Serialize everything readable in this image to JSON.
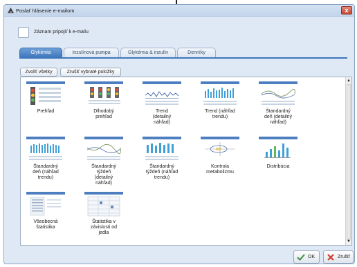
{
  "window": {
    "title": "Poslať hlásenie e-mailom",
    "close_glyph": "x"
  },
  "attach": {
    "label": "Záznam pripojiť k e-mailu",
    "checked": false
  },
  "tabs": [
    {
      "label": "Glykémia",
      "active": true
    },
    {
      "label": "Inzulínová pumpa",
      "active": false
    },
    {
      "label": "Glykémia & inzulín",
      "active": false
    },
    {
      "label": "Denníky",
      "active": false
    }
  ],
  "actions": {
    "select_all": "Zvoliť všetky",
    "deselect": "Zrušiť vybraté položky"
  },
  "reports": [
    {
      "label": "Prehľad",
      "icon": "traffic-light-grid-icon"
    },
    {
      "label": "Dlhodobý\nprehľad",
      "icon": "traffic-light-row-icon"
    },
    {
      "label": "Trend\n(detailný\nnáhľad)",
      "icon": "trend-detail-icon"
    },
    {
      "label": "Trend (náhľad\ntrendu)",
      "icon": "trend-bars-icon"
    },
    {
      "label": "Štandardný\ndeň (detailný\nnáhľad)",
      "icon": "standard-day-detail-icon"
    },
    {
      "label": "Štandardný\ndeň (náhľad\ntrendu)",
      "icon": "standard-day-trend-icon"
    },
    {
      "label": "Štandardný\ntýždeň\n(detailný\nnáhľad)",
      "icon": "standard-week-detail-icon"
    },
    {
      "label": "Štandardný\ntýždeň (náhľad\ntrendu)",
      "icon": "standard-week-trend-icon"
    },
    {
      "label": "Kontrola\nmetabolizmu",
      "icon": "metabolism-icon"
    },
    {
      "label": "Distribúcia",
      "icon": "distribution-icon"
    },
    {
      "label": "Všeobecná\nštatistika",
      "icon": "general-stats-icon"
    },
    {
      "label": "Štatistika v\nzávislosti od\njedla",
      "icon": "meal-stats-icon"
    }
  ],
  "footer": {
    "ok": "OK",
    "cancel": "Zrušiť"
  },
  "colors": {
    "accent": "#3f77bd",
    "dialog_bg": "#dfe9f5"
  }
}
